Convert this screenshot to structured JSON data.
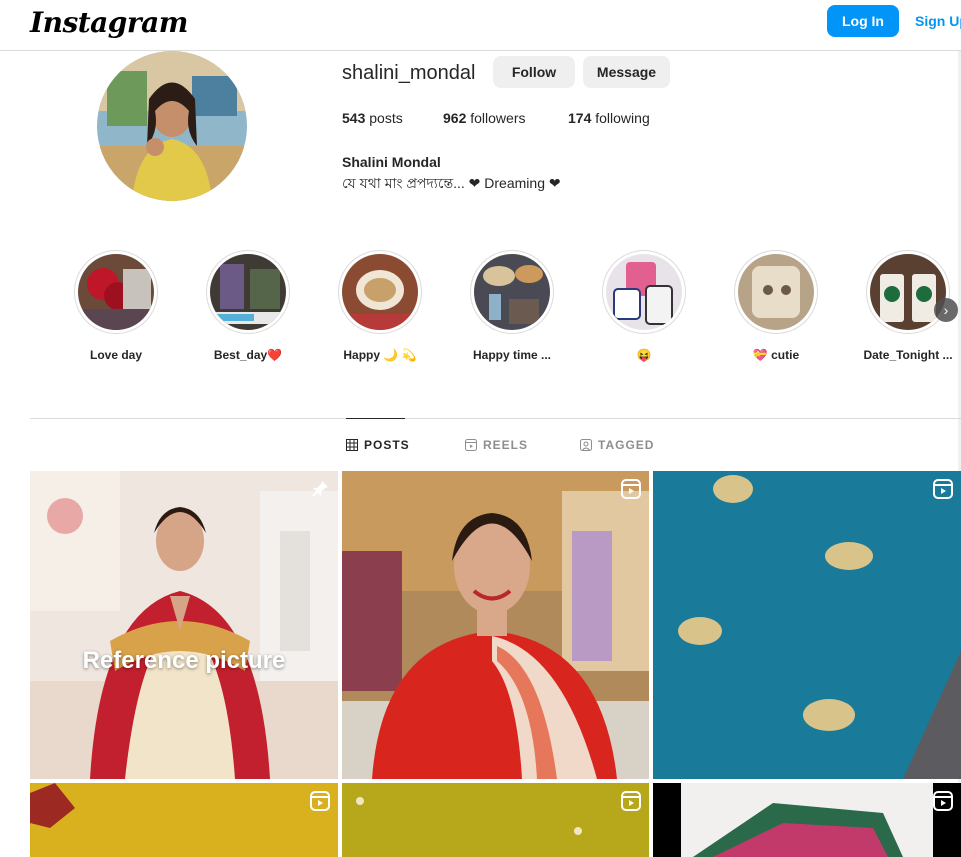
{
  "app": {
    "logo": "Instagram"
  },
  "topbar": {
    "login_label": "Log In",
    "signup_label": "Sign Up"
  },
  "profile": {
    "username": "shalini_mondal",
    "follow_label": "Follow",
    "message_label": "Message",
    "posts_count": "543",
    "posts_label": "posts",
    "followers_count": "962",
    "followers_label": "followers",
    "following_count": "174",
    "following_label": "following",
    "full_name": "Shalini Mondal",
    "bio": "যে যথা মাং প্রপদ্যন্তে... ❤ Dreaming ❤"
  },
  "highlights": [
    {
      "label": "Love day"
    },
    {
      "label": "Best_day❤️"
    },
    {
      "label": "Happy 🌙 💫"
    },
    {
      "label": "Happy time ..."
    },
    {
      "label": "😝"
    },
    {
      "label": "💝 cutie"
    },
    {
      "label": "Date_Tonight ..."
    }
  ],
  "tabs": [
    {
      "label": "POSTS",
      "icon": "grid-icon",
      "active": true
    },
    {
      "label": "REELS",
      "icon": "reels-icon",
      "active": false
    },
    {
      "label": "TAGGED",
      "icon": "tagged-icon",
      "active": false
    }
  ],
  "posts": [
    {
      "caption": "Reference picture",
      "badge": "pin-icon"
    },
    {
      "caption": "",
      "badge": "reel-icon"
    },
    {
      "caption": "",
      "badge": "reel-icon"
    },
    {
      "caption": "",
      "badge": "reel-icon"
    },
    {
      "caption": "",
      "badge": "reel-icon"
    },
    {
      "caption": "",
      "badge": "reel-icon"
    }
  ],
  "colors": {
    "accent": "#0095f6",
    "border": "#dbdbdb",
    "secondary_button": "#efefef",
    "muted_text": "#8e8e8e"
  }
}
